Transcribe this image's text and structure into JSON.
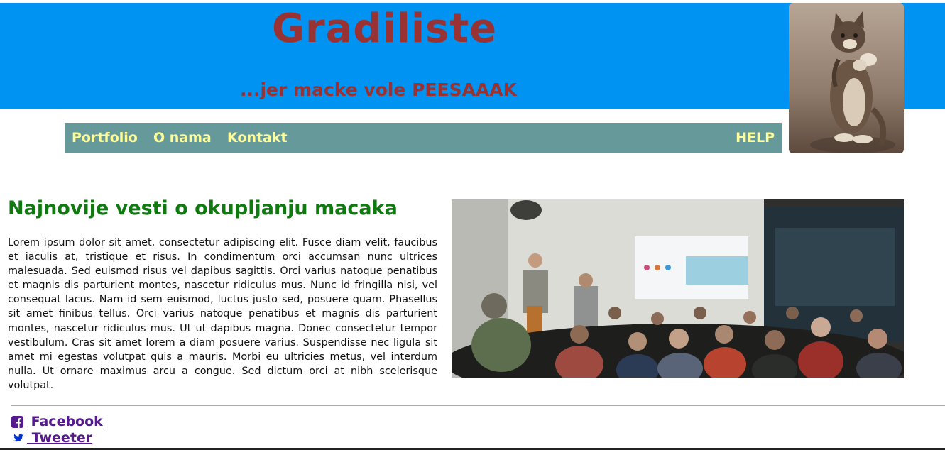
{
  "header": {
    "title": "Gradiliste",
    "tagline": "...jer macke vole PEESAAAK"
  },
  "nav": {
    "items": [
      {
        "label": "Portfolio"
      },
      {
        "label": "O nama"
      },
      {
        "label": "Kontakt"
      }
    ],
    "help_label": "HELP"
  },
  "article": {
    "title": "Najnovije vesti o okupljanju macaka",
    "body": "Lorem ipsum dolor sit amet, consectetur adipiscing elit. Fusce diam velit, faucibus et iaculis at, tristique et risus. In condimentum orci accumsan nunc ultrices malesuada. Sed euismod risus vel dapibus sagittis. Orci varius natoque penatibus et magnis dis parturient montes, nascetur ridiculus mus. Nunc id fringilla nisi, vel consequat lacus. Nam id sem euismod, luctus justo sed, posuere quam. Phasellus sit amet finibus tellus. Orci varius natoque penatibus et magnis dis parturient montes, nascetur ridiculus mus. Ut ut dapibus magna. Donec consectetur tempor vestibulum. Cras sit amet lorem a diam posuere varius. Suspendisse nec ligula sit amet mi egestas volutpat quis a mauris. Morbi eu ultricies metus, vel interdum nulla. Ut ornare maximus arcu a congue. Sed dictum orci at nibh scelerisque volutpat."
  },
  "footer": {
    "facebook": {
      "label": " Facebook",
      "icon": "facebook-icon"
    },
    "tweeter": {
      "label": " Tweeter",
      "icon": "twitter-icon"
    }
  },
  "colors": {
    "banner": "#0093f2",
    "title": "#993333",
    "nav_background": "#669999",
    "nav_text": "#ffff99",
    "article_title": "#0f7a0f",
    "visited_link": "#551a8b"
  }
}
